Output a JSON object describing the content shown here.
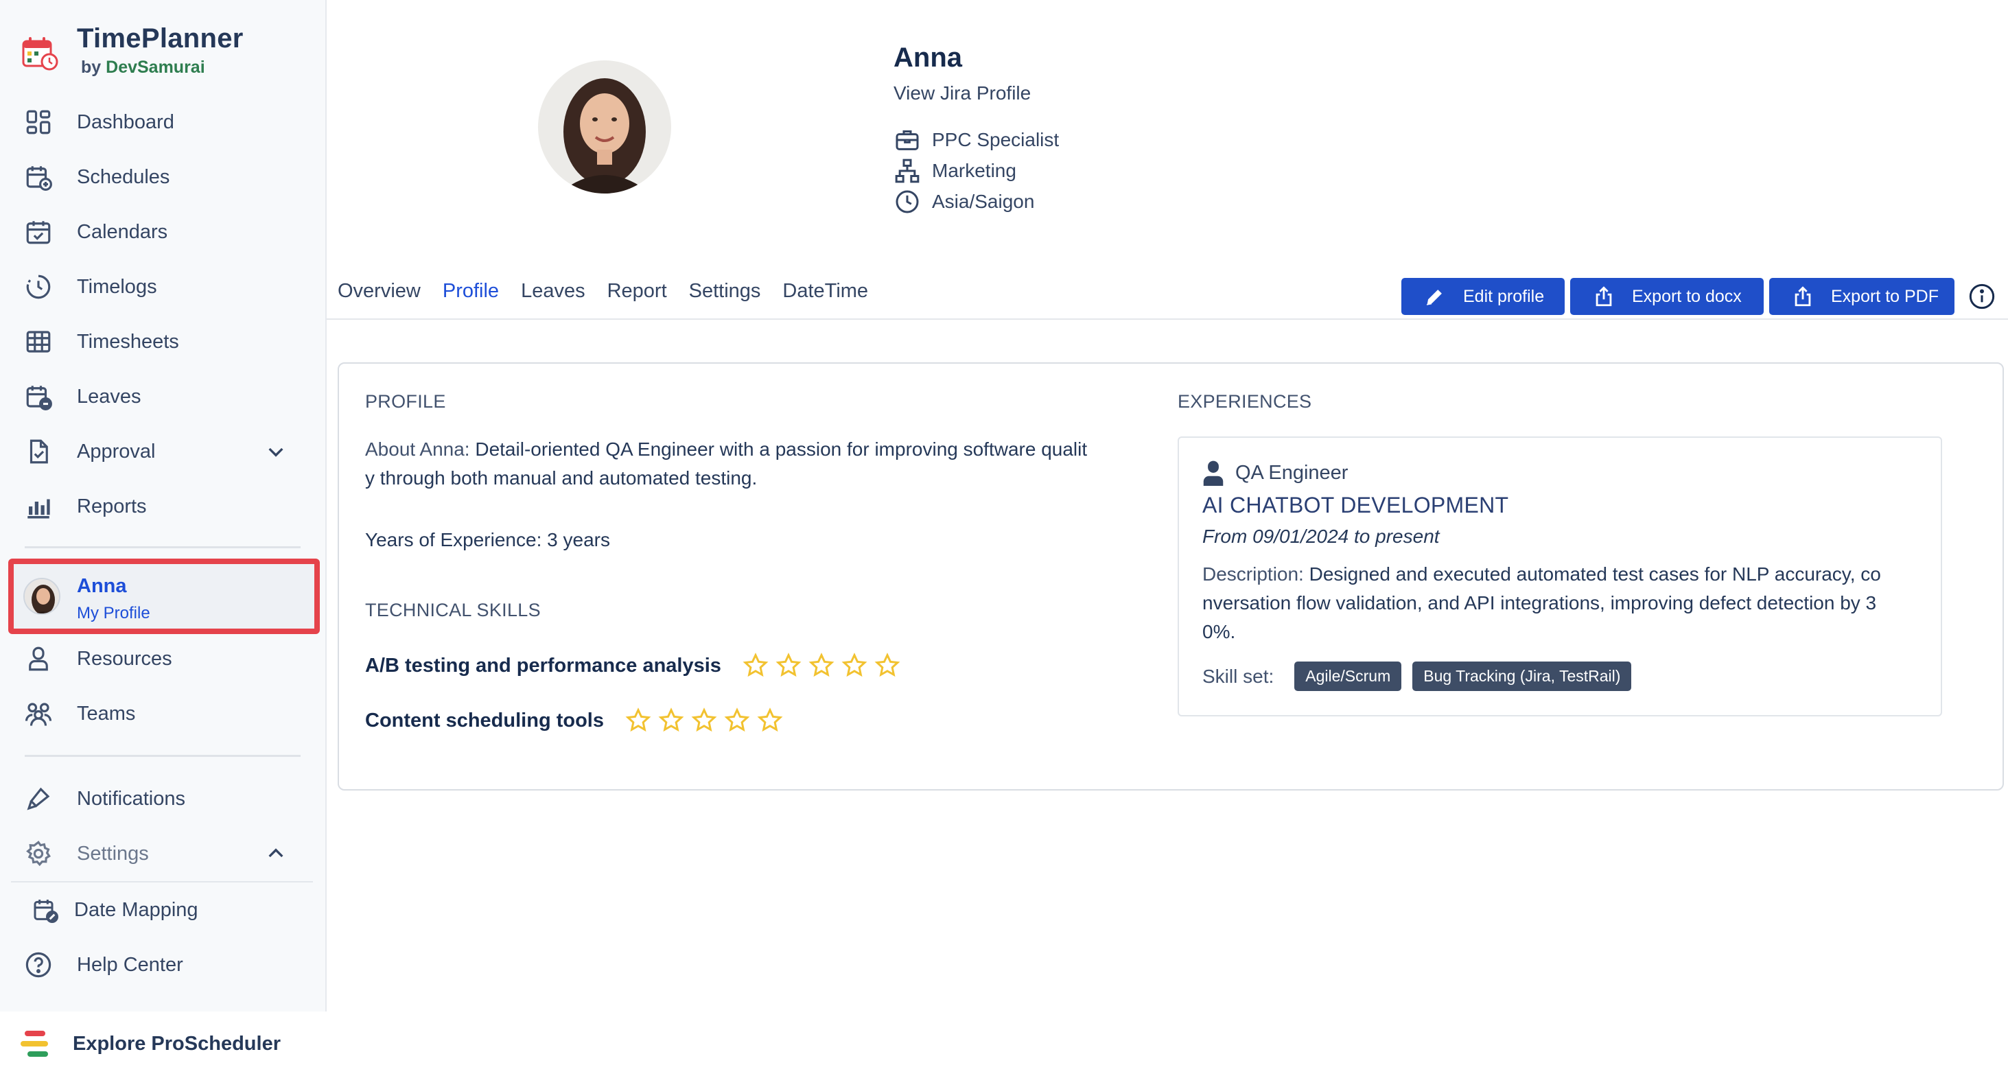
{
  "brand": {
    "title": "TimePlanner",
    "by": "by",
    "company": "DevSamurai"
  },
  "sidebar": {
    "items": [
      {
        "label": "Dashboard"
      },
      {
        "label": "Schedules"
      },
      {
        "label": "Calendars"
      },
      {
        "label": "Timelogs"
      },
      {
        "label": "Timesheets"
      },
      {
        "label": "Leaves"
      },
      {
        "label": "Approval"
      },
      {
        "label": "Reports"
      }
    ],
    "profile": {
      "name": "Anna",
      "subtitle": "My Profile"
    },
    "items2": [
      {
        "label": "Resources"
      },
      {
        "label": "Teams"
      }
    ],
    "notifications": "Notifications",
    "settings": "Settings",
    "settings_sub": [
      {
        "label": "Date Mapping"
      }
    ],
    "help": "Help Center",
    "explore": "Explore ProScheduler"
  },
  "header": {
    "name": "Anna",
    "jira_link": "View Jira Profile",
    "job_title": "PPC Specialist",
    "department": "Marketing",
    "timezone": "Asia/Saigon"
  },
  "tabs": [
    {
      "label": "Overview"
    },
    {
      "label": "Profile"
    },
    {
      "label": "Leaves"
    },
    {
      "label": "Report"
    },
    {
      "label": "Settings"
    },
    {
      "label": "DateTime"
    }
  ],
  "actions": {
    "edit": "Edit profile",
    "export_docx": "Export to docx",
    "export_pdf": "Export to PDF"
  },
  "profile": {
    "section_title": "PROFILE",
    "about_label": "About Anna:",
    "about_text_1": "Detail-oriented QA Engineer with a passion for improving software qualit",
    "about_text_2": "y through both manual and automated testing.",
    "years_label": "Years of Experience:",
    "years_value": "3 years",
    "skills_title": "TECHNICAL SKILLS",
    "skills": [
      {
        "name": "A/B testing and performance analysis",
        "rating": 0,
        "max": 5
      },
      {
        "name": "Content scheduling tools",
        "rating": 0,
        "max": 5
      }
    ]
  },
  "experiences": {
    "section_title": "EXPERIENCES",
    "items": [
      {
        "role": "QA Engineer",
        "project": "AI CHATBOT DEVELOPMENT",
        "dates": "From 09/01/2024 to present",
        "desc_label": "Description:",
        "desc_line_1": "Designed and executed automated test cases for NLP accuracy, co",
        "desc_line_2": "nversation flow validation, and API integrations, improving defect detection by 3",
        "desc_line_3": "0%.",
        "skillset_label": "Skill set:",
        "skills": [
          "Agile/Scrum",
          "Bug Tracking (Jira, TestRail)"
        ]
      }
    ]
  },
  "colors": {
    "accent": "#1f4fc9",
    "highlight": "#e5434b",
    "star": "#f2c230",
    "chip": "#3e4d66"
  }
}
